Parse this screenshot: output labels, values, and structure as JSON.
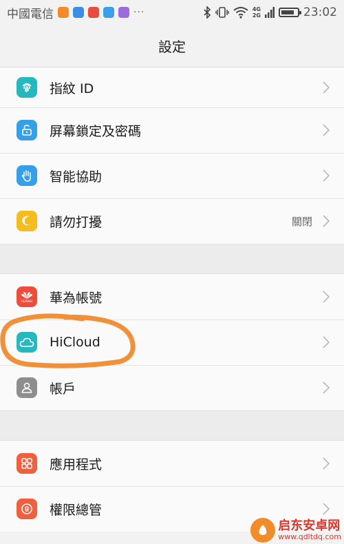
{
  "status_bar": {
    "carrier": "中國電信",
    "dots": "···",
    "network_top": "4G",
    "network_bottom": "2G",
    "time": "23:02",
    "battery_level": 0.8
  },
  "header": {
    "title": "設定"
  },
  "groups": [
    {
      "items": [
        {
          "label": "指紋 ID",
          "icon": "fingerprint-icon",
          "color": "#26b8bf"
        },
        {
          "label": "屏幕鎖定及密碼",
          "icon": "lock-icon",
          "color": "#35a0e8"
        },
        {
          "label": "智能協助",
          "icon": "hand-icon",
          "color": "#35a0e8"
        },
        {
          "label": "請勿打擾",
          "icon": "moon-icon",
          "color": "#f5bc1e",
          "value": "關閉"
        }
      ]
    },
    {
      "items": [
        {
          "label": "華為帳號",
          "icon": "huawei-icon",
          "color": "#f04c3c",
          "icon_text": "HUAWEI"
        },
        {
          "label": "HiCloud",
          "icon": "cloud-icon",
          "color": "#26b8bf"
        },
        {
          "label": "帳戶",
          "icon": "user-icon",
          "color": "#8e8e8e"
        }
      ]
    },
    {
      "items": [
        {
          "label": "應用程式",
          "icon": "apps-icon",
          "color": "#f0603c"
        },
        {
          "label": "權限總管",
          "icon": "permission-icon",
          "color": "#f0603c"
        }
      ]
    }
  ],
  "annotation_color": "#f0913a",
  "watermark": {
    "name": "启东安卓网",
    "url": "www.qdltdq.com"
  }
}
